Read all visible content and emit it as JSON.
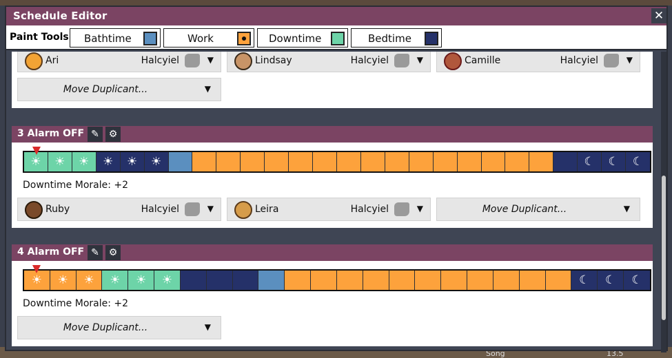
{
  "window": {
    "title": "Schedule Editor",
    "close": "✕"
  },
  "paint_tools": {
    "label": "Paint Tools:",
    "tools": [
      {
        "label": "Bathtime",
        "color": "#5b8fbf"
      },
      {
        "label": "Work",
        "color": "#fda23c"
      },
      {
        "label": "Downtime",
        "color": "#6dd4a8"
      },
      {
        "label": "Bedtime",
        "color": "#253169"
      }
    ]
  },
  "colors": {
    "bathtime": "#5b8fbf",
    "work": "#fda23c",
    "downtime": "#6dd4a8",
    "bedtime": "#253169",
    "header": "#7b4463"
  },
  "schedule_prev": {
    "dupes": [
      {
        "name": "Ari",
        "world": "Halcyiel"
      },
      {
        "name": "Lindsay",
        "world": "Halcyiel"
      },
      {
        "name": "Camille",
        "world": "Halcyiel"
      }
    ],
    "move_label": "Move Duplicant..."
  },
  "schedule_3": {
    "name": "3  Alarm OFF",
    "morale": "Downtime Morale: +2",
    "blocks": [
      "downtime",
      "downtime",
      "downtime",
      "bedtime",
      "bedtime",
      "bedtime",
      "bathtime",
      "work",
      "work",
      "work",
      "work",
      "work",
      "work",
      "work",
      "work",
      "work",
      "work",
      "work",
      "work",
      "work",
      "work",
      "work",
      "bedtime",
      "bedtime",
      "bedtime",
      "bedtime"
    ],
    "dupes": [
      {
        "name": "Ruby",
        "world": "Halcyiel"
      },
      {
        "name": "Leira",
        "world": "Halcyiel"
      }
    ],
    "move_label": "Move Duplicant..."
  },
  "schedule_4": {
    "name": "4  Alarm OFF",
    "morale": "Downtime Morale: +2",
    "blocks": [
      "work",
      "work",
      "work",
      "downtime",
      "downtime",
      "downtime",
      "bedtime",
      "bedtime",
      "bedtime",
      "bathtime",
      "work",
      "work",
      "work",
      "work",
      "work",
      "work",
      "work",
      "work",
      "work",
      "work",
      "work",
      "bedtime",
      "bedtime",
      "bedtime"
    ],
    "move_label": "Move Duplicant..."
  },
  "icons": {
    "sun": "sunrise-icon",
    "moon": "moon-icon",
    "edit": "pencil-icon",
    "settings": "gear-icon",
    "world": "asteroid-icon",
    "caret": "chevron-down-icon"
  },
  "bottom_bar": {
    "label": "Song",
    "value": "13.5"
  }
}
